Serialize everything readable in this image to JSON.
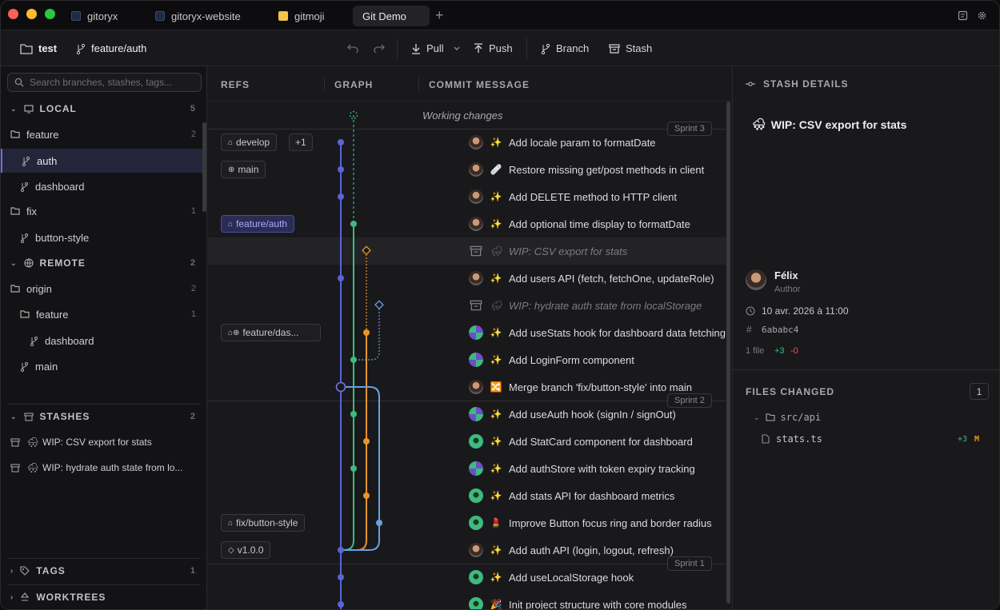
{
  "tabs": [
    {
      "label": "gitoryx",
      "icon": "gitoryx-icon"
    },
    {
      "label": "gitoryx-website",
      "icon": "gitoryx-icon"
    },
    {
      "label": "gitmoji",
      "icon": "gitmoji-icon"
    },
    {
      "label": "Git Demo",
      "active": true
    }
  ],
  "toolbar": {
    "repo": "test",
    "branch": "feature/auth",
    "pull": "Pull",
    "push": "Push",
    "branch_btn": "Branch",
    "stash": "Stash"
  },
  "sidebar": {
    "search_placeholder": "Search branches, stashes, tags...",
    "local": {
      "label": "LOCAL",
      "count": "5"
    },
    "feature": {
      "label": "feature",
      "count": "2"
    },
    "auth": "auth",
    "dashboard": "dashboard",
    "fix": {
      "label": "fix",
      "count": "1"
    },
    "button_style": "button-style",
    "remote": {
      "label": "REMOTE",
      "count": "2"
    },
    "origin": {
      "label": "origin",
      "count": "2"
    },
    "origin_feature": {
      "label": "feature",
      "count": "1"
    },
    "origin_dashboard": "dashboard",
    "origin_main": "main",
    "stashes": {
      "label": "STASHES",
      "count": "2"
    },
    "stash1": "WIP: CSV export for stats",
    "stash2": "WIP: hydrate auth state from lo...",
    "tags": {
      "label": "TAGS",
      "count": "1"
    },
    "worktrees": {
      "label": "WORKTREES"
    }
  },
  "columns": {
    "refs": "REFS",
    "graph": "GRAPH",
    "message": "COMMIT MESSAGE"
  },
  "refs": {
    "develop": "develop",
    "plus": "+1",
    "main": "main",
    "feature_auth": "feature/auth",
    "feature_das": "feature/das...",
    "fix_button": "fix/button-style",
    "tag": "v1.0.0"
  },
  "sprints": {
    "s3": "Sprint 3",
    "s2": "Sprint 2",
    "s1": "Sprint 1"
  },
  "working": "Working changes",
  "commits": [
    {
      "emoji": "✨",
      "msg": "Add locale param to formatDate",
      "author": "felix"
    },
    {
      "emoji": "🩹",
      "msg": "Restore missing get/post methods in client",
      "author": "felix"
    },
    {
      "emoji": "✨",
      "msg": "Add DELETE method to HTTP client",
      "author": "felix"
    },
    {
      "emoji": "✨",
      "msg": "Add optional time display to formatDate",
      "author": "felix"
    },
    {
      "emoji": "🌨",
      "msg": "WIP: CSV export for stats",
      "stash": true
    },
    {
      "emoji": "✨",
      "msg": "Add users API (fetch, fetchOne, updateRole)",
      "author": "felix"
    },
    {
      "emoji": "🌨",
      "msg": "WIP: hydrate auth state from localStorage",
      "stash": true
    },
    {
      "emoji": "✨",
      "msg": "Add useStats hook for dashboard data fetching",
      "author": "purple"
    },
    {
      "emoji": "✨",
      "msg": "Add LoginForm component",
      "author": "purple"
    },
    {
      "emoji": "🔀",
      "msg": "Merge branch 'fix/button-style' into main",
      "author": "felix"
    },
    {
      "emoji": "✨",
      "msg": "Add useAuth hook (signIn / signOut)",
      "author": "purple"
    },
    {
      "emoji": "✨",
      "msg": "Add StatCard component for dashboard",
      "author": "green"
    },
    {
      "emoji": "✨",
      "msg": "Add authStore with token expiry tracking",
      "author": "purple"
    },
    {
      "emoji": "✨",
      "msg": "Add stats API for dashboard metrics",
      "author": "green"
    },
    {
      "emoji": "💄",
      "msg": "Improve Button focus ring and border radius",
      "author": "green"
    },
    {
      "emoji": "✨",
      "msg": "Add auth API (login, logout, refresh)",
      "author": "felix"
    },
    {
      "emoji": "✨",
      "msg": "Add useLocalStorage hook",
      "author": "green"
    },
    {
      "emoji": "🎉",
      "msg": "Init project structure with core modules",
      "author": "green"
    }
  ],
  "details": {
    "header": "STASH DETAILS",
    "title": "WIP: CSV export for stats",
    "title_emoji": "🌨",
    "author_name": "Félix",
    "author_role": "Author",
    "date": "10 avr. 2026 à 11:00",
    "hash": "6ababc4",
    "files_count": "1 file",
    "additions": "+3",
    "deletions": "-0",
    "files_header": "FILES CHANGED",
    "files_badge": "1",
    "folder": "src/api",
    "file": "stats.ts",
    "file_add": "+3",
    "file_status": "M"
  },
  "colors": {
    "blue": "#5c63d8",
    "green": "#3dba7e",
    "orange": "#e8952a",
    "lightblue": "#6aa0e0",
    "accent": "#a8acff"
  }
}
